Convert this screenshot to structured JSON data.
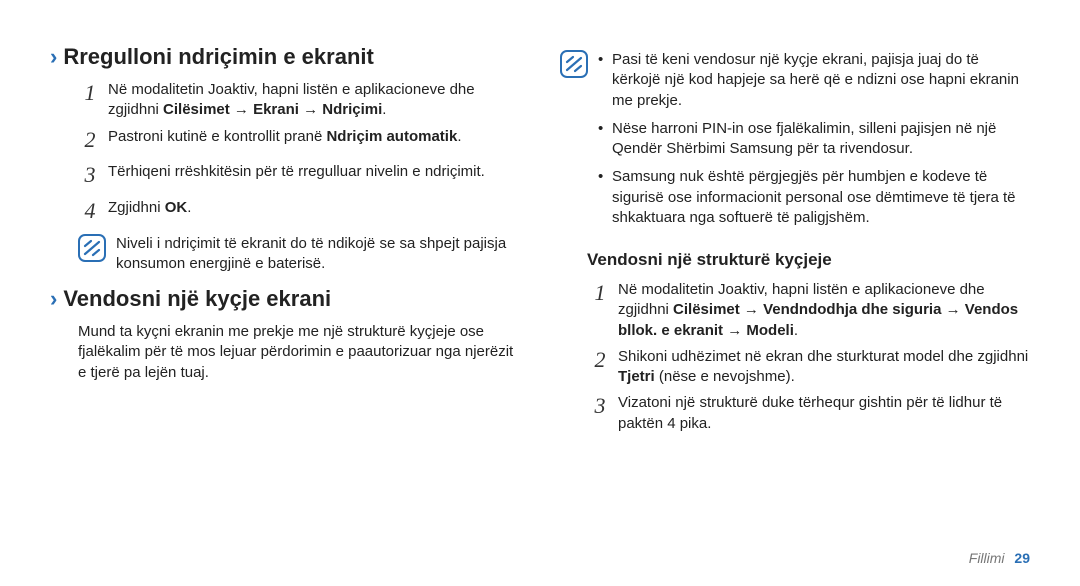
{
  "colors": {
    "accent": "#2a6fb5"
  },
  "left": {
    "h1": "Rregulloni ndriçimin e ekranit",
    "steps": [
      {
        "n": "1",
        "pre": "Në modalitetin Joaktiv, hapni listën e aplikacioneve dhe zgjidhni ",
        "bold": "Cilësimet → Ekrani → Ndriçimi",
        "post": "."
      },
      {
        "n": "2",
        "pre": "Pastroni kutinë e kontrollit pranë ",
        "bold": "Ndriçim automatik",
        "post": "."
      },
      {
        "n": "3",
        "pre": "Tërhiqeni rrëshkitësin për të rregulluar nivelin e ndriçimit.",
        "bold": "",
        "post": ""
      },
      {
        "n": "4",
        "pre": "Zgjidhni ",
        "bold": "OK",
        "post": "."
      }
    ],
    "note": "Niveli i ndriçimit të ekranit do të ndikojë se sa shpejt pajisja konsumon energjinë e baterisë.",
    "h2": "Vendosni një kyçje ekrani",
    "h2_text": "Mund ta kyçni ekranin me prekje me një strukturë kyçjeje ose fjalëkalim për të mos lejuar përdorimin e paautorizuar nga njerëzit e tjerë pa lejën tuaj."
  },
  "right": {
    "note_bullets": [
      "Pasi të keni vendosur një kyçje ekrani, pajisja juaj do të kërkojë një kod hapjeje sa herë që e ndizni ose hapni ekranin me prekje.",
      "Nëse harroni PIN-in ose fjalëkalimin, silleni pajisjen në një Qendër Shërbimi Samsung për ta rivendosur.",
      "Samsung nuk është përgjegjës për humbjen e kodeve të sigurisë ose informacionit personal ose dëmtimeve të tjera të shkaktuara nga softuerë të paligjshëm."
    ],
    "sub": "Vendosni një strukturë kyçjeje",
    "steps": [
      {
        "n": "1",
        "pre": "Në modalitetin Joaktiv, hapni listën e aplikacioneve dhe zgjidhni ",
        "bold": "Cilësimet → Vendndodhja dhe siguria → Vendos bllok. e ekranit → Modeli",
        "post": "."
      },
      {
        "n": "2",
        "pre": "Shikoni udhëzimet në ekran dhe sturkturat model dhe zgjidhni ",
        "bold": "Tjetri",
        "post": " (nëse e nevojshme)."
      },
      {
        "n": "3",
        "pre": "Vizatoni një strukturë duke tërhequr gishtin për të lidhur të paktën 4 pika.",
        "bold": "",
        "post": ""
      }
    ]
  },
  "footer": {
    "label": "Fillimi",
    "page": "29"
  }
}
